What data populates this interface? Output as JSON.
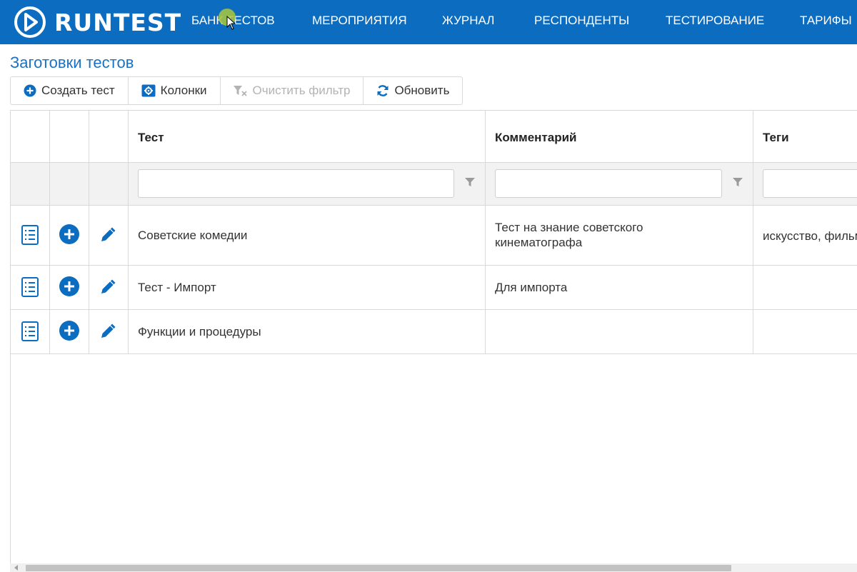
{
  "header": {
    "logo_text": "RUNTEST",
    "nav": [
      {
        "label": "БАНК ТЕСТОВ"
      },
      {
        "label": "МЕРОПРИЯТИЯ"
      },
      {
        "label": "ЖУРНАЛ"
      },
      {
        "label": "РЕСПОНДЕНТЫ"
      },
      {
        "label": "ТЕСТИРОВАНИЕ"
      },
      {
        "label": "ТАРИФЫ"
      }
    ]
  },
  "page": {
    "title": "Заготовки тестов"
  },
  "toolbar": {
    "create_label": "Создать тест",
    "columns_label": "Колонки",
    "clear_filter_label": "Очистить фильтр",
    "refresh_label": "Обновить"
  },
  "grid": {
    "headers": {
      "test": "Тест",
      "comment": "Комментарий",
      "tags": "Теги"
    },
    "filters": {
      "test": "",
      "comment": "",
      "tags": ""
    },
    "rows": [
      {
        "test": "Советские комедии",
        "comment_line1": "Тест на знание советского",
        "comment_line2": "кинематографа",
        "tags": "искусство, фильмы"
      },
      {
        "test": "Тест - Импорт",
        "comment_line1": "Для импорта",
        "comment_line2": "",
        "tags": ""
      },
      {
        "test": "Функции и процедуры",
        "comment_line1": "",
        "comment_line2": "",
        "tags": ""
      }
    ]
  },
  "colors": {
    "brand": "#0b6cc0",
    "accent": "#1a72c2"
  },
  "icons": [
    "logo-play-icon",
    "plus-circle-icon",
    "gear-icon",
    "filter-clear-icon",
    "refresh-icon",
    "filter-icon",
    "list-icon",
    "add-circle-icon",
    "pencil-icon"
  ]
}
